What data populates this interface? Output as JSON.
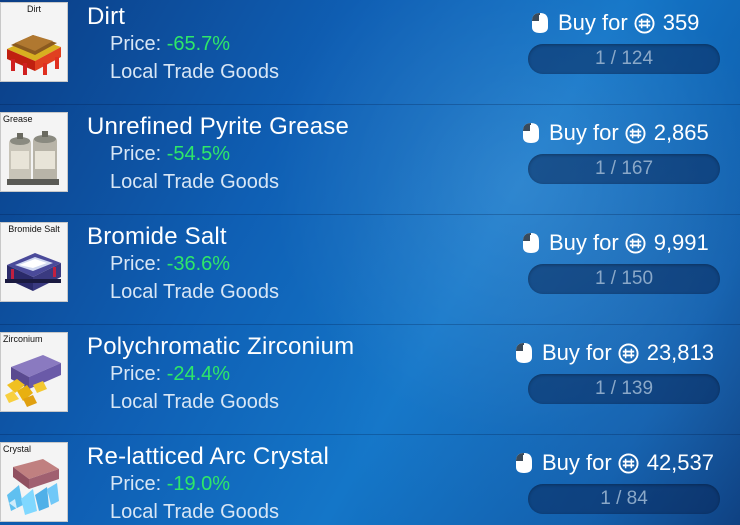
{
  "items": [
    {
      "thumb_label": "Dirt",
      "name": "Dirt",
      "price_label": "Price: ",
      "price_value": "-65.7%",
      "category": "Local Trade Goods",
      "buy_label": "Buy for",
      "buy_price": "359",
      "quantity": "1 / 124",
      "icon": "dirt-icon"
    },
    {
      "thumb_label": "Grease",
      "name": "Unrefined Pyrite Grease",
      "price_label": "Price: ",
      "price_value": "-54.5%",
      "category": "Local Trade Goods",
      "buy_label": "Buy for",
      "buy_price": "2,865",
      "quantity": "1 / 167",
      "icon": "grease-canisters-icon"
    },
    {
      "thumb_label": "Bromide Salt",
      "name": "Bromide Salt",
      "price_label": "Price: ",
      "price_value": "-36.6%",
      "category": "Local Trade Goods",
      "buy_label": "Buy for",
      "buy_price": "9,991",
      "quantity": "1 / 150",
      "icon": "salt-crate-icon"
    },
    {
      "thumb_label": "Zirconium",
      "name": "Polychromatic Zirconium",
      "price_label": "Price: ",
      "price_value": "-24.4%",
      "category": "Local Trade Goods",
      "buy_label": "Buy for",
      "buy_price": "23,813",
      "quantity": "1 / 139",
      "icon": "zirconium-case-icon"
    },
    {
      "thumb_label": "Crystal",
      "name": "Re-latticed Arc Crystal",
      "price_label": "Price: ",
      "price_value": "-19.0%",
      "category": "Local Trade Goods",
      "buy_label": "Buy for",
      "buy_price": "42,537",
      "quantity": "1 / 84",
      "icon": "arc-crystal-icon"
    }
  ],
  "colors": {
    "discount": "#2ee868",
    "text": "#ffffff",
    "muted": "#d8e6f5"
  }
}
